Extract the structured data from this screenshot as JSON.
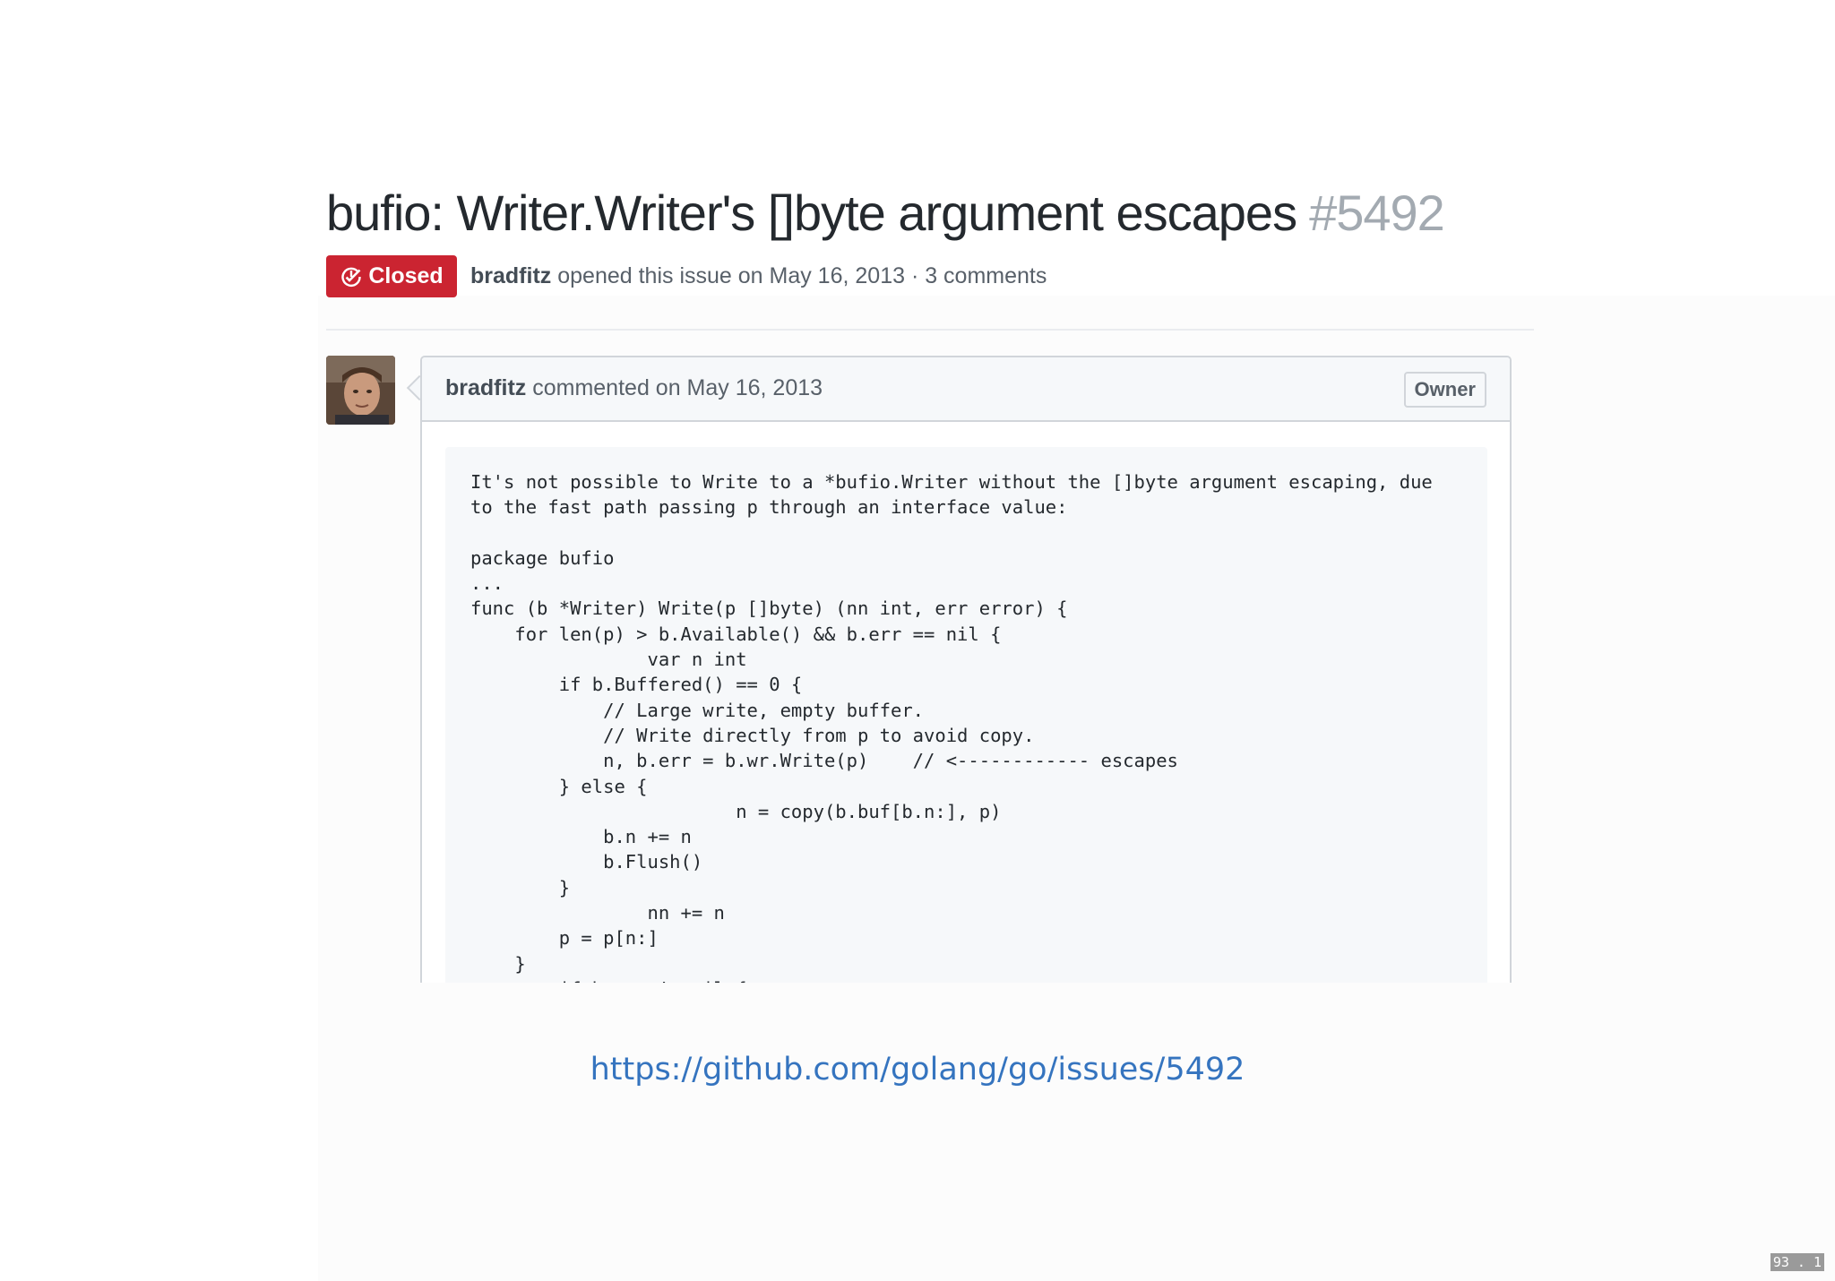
{
  "issue": {
    "title": "bufio: Writer.Writer's []byte argument escapes",
    "number": "#5492",
    "state": "Closed",
    "state_color": "#cb2431",
    "author": "bradfitz",
    "meta_text": " opened this issue on May 16, 2013 · 3 comments"
  },
  "comment": {
    "author": "bradfitz",
    "header_text": " commented on May 16, 2013",
    "role_badge": "Owner",
    "avatar_icon": "user-avatar",
    "body": "It's not possible to Write to a *bufio.Writer without the []byte argument escaping, due\nto the fast path passing p through an interface value:\n\npackage bufio\n...\nfunc (b *Writer) Write(p []byte) (nn int, err error) {\n    for len(p) > b.Available() && b.err == nil {\n                var n int\n        if b.Buffered() == 0 {\n            // Large write, empty buffer.\n            // Write directly from p to avoid copy.\n            n, b.err = b.wr.Write(p)    // <------------ escapes\n        } else {\n                        n = copy(b.buf[b.n:], p)\n            b.n += n\n            b.Flush()\n        }\n                nn += n\n        p = p[n:]\n    }\n        if b.err != nil {"
  },
  "footer": {
    "link": "https://github.com/golang/go/issues/5492",
    "link_color": "#3574bf",
    "slide_number": "93 . 1"
  }
}
